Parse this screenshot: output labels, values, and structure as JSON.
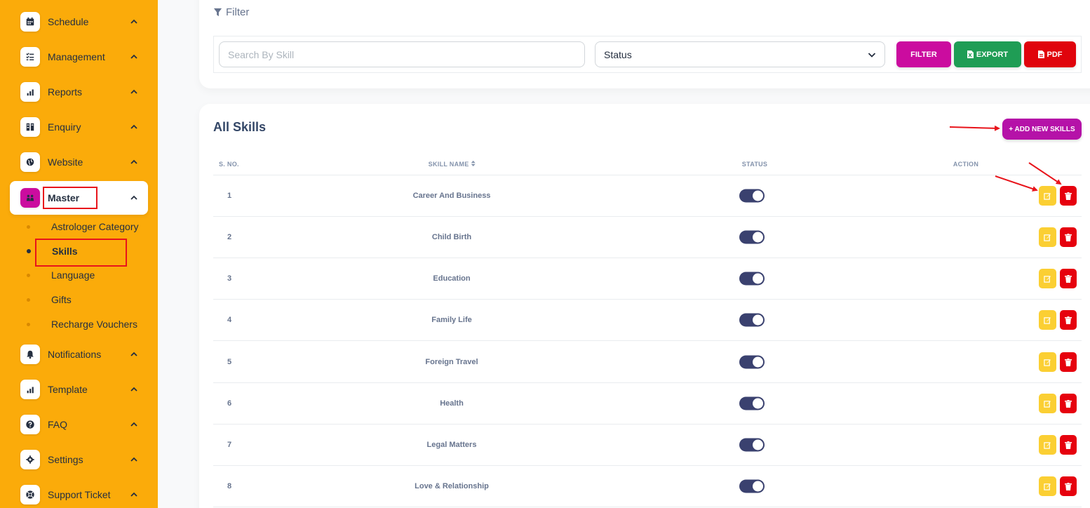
{
  "sidebar": {
    "items": [
      {
        "label": "Schedule",
        "icon": "calendar-icon"
      },
      {
        "label": "Management",
        "icon": "checklist-icon"
      },
      {
        "label": "Reports",
        "icon": "bar-chart-icon"
      },
      {
        "label": "Enquiry",
        "icon": "enquiry-icon"
      },
      {
        "label": "Website",
        "icon": "globe-icon"
      },
      {
        "label": "Master",
        "icon": "users-icon"
      },
      {
        "label": "Notifications",
        "icon": "bell-icon"
      },
      {
        "label": "Template",
        "icon": "bar-chart-icon"
      },
      {
        "label": "FAQ",
        "icon": "question-icon"
      },
      {
        "label": "Settings",
        "icon": "gear-icon"
      },
      {
        "label": "Support Ticket",
        "icon": "support-icon"
      }
    ],
    "master_sub": [
      {
        "label": "Astrologer Category"
      },
      {
        "label": "Skills"
      },
      {
        "label": "Language"
      },
      {
        "label": "Gifts"
      },
      {
        "label": "Recharge Vouchers"
      }
    ],
    "colors": {
      "background": "#fbab0a",
      "active_icon": "#cb0c9f"
    }
  },
  "filter": {
    "title": "Filter",
    "search_placeholder": "Search By Skill",
    "status_value": "Status",
    "filter_label": "FILTER",
    "export_label": "EXPORT",
    "pdf_label": "PDF"
  },
  "skills": {
    "title": "All Skills",
    "add_label": "+ ADD NEW SKILLS",
    "columns": [
      "S. NO.",
      "SKILL NAME",
      "STATUS",
      "ACTION"
    ],
    "rows": [
      {
        "sno": "1",
        "name": "Career And Business",
        "status": true
      },
      {
        "sno": "2",
        "name": "Child Birth",
        "status": true
      },
      {
        "sno": "3",
        "name": "Education",
        "status": true
      },
      {
        "sno": "4",
        "name": "Family Life",
        "status": true
      },
      {
        "sno": "5",
        "name": "Foreign Travel",
        "status": true
      },
      {
        "sno": "6",
        "name": "Health",
        "status": true
      },
      {
        "sno": "7",
        "name": "Legal Matters",
        "status": true
      },
      {
        "sno": "8",
        "name": "Love & Relationship",
        "status": true
      }
    ]
  },
  "colors": {
    "filter_btn": "#cb0c9f",
    "export_btn": "#1f9d55",
    "pdf_btn": "#e0040c",
    "edit_btn": "#fbcf33",
    "delete_btn": "#e6010e",
    "toggle_on": "#3a416f",
    "annotation": "#e8141b"
  }
}
